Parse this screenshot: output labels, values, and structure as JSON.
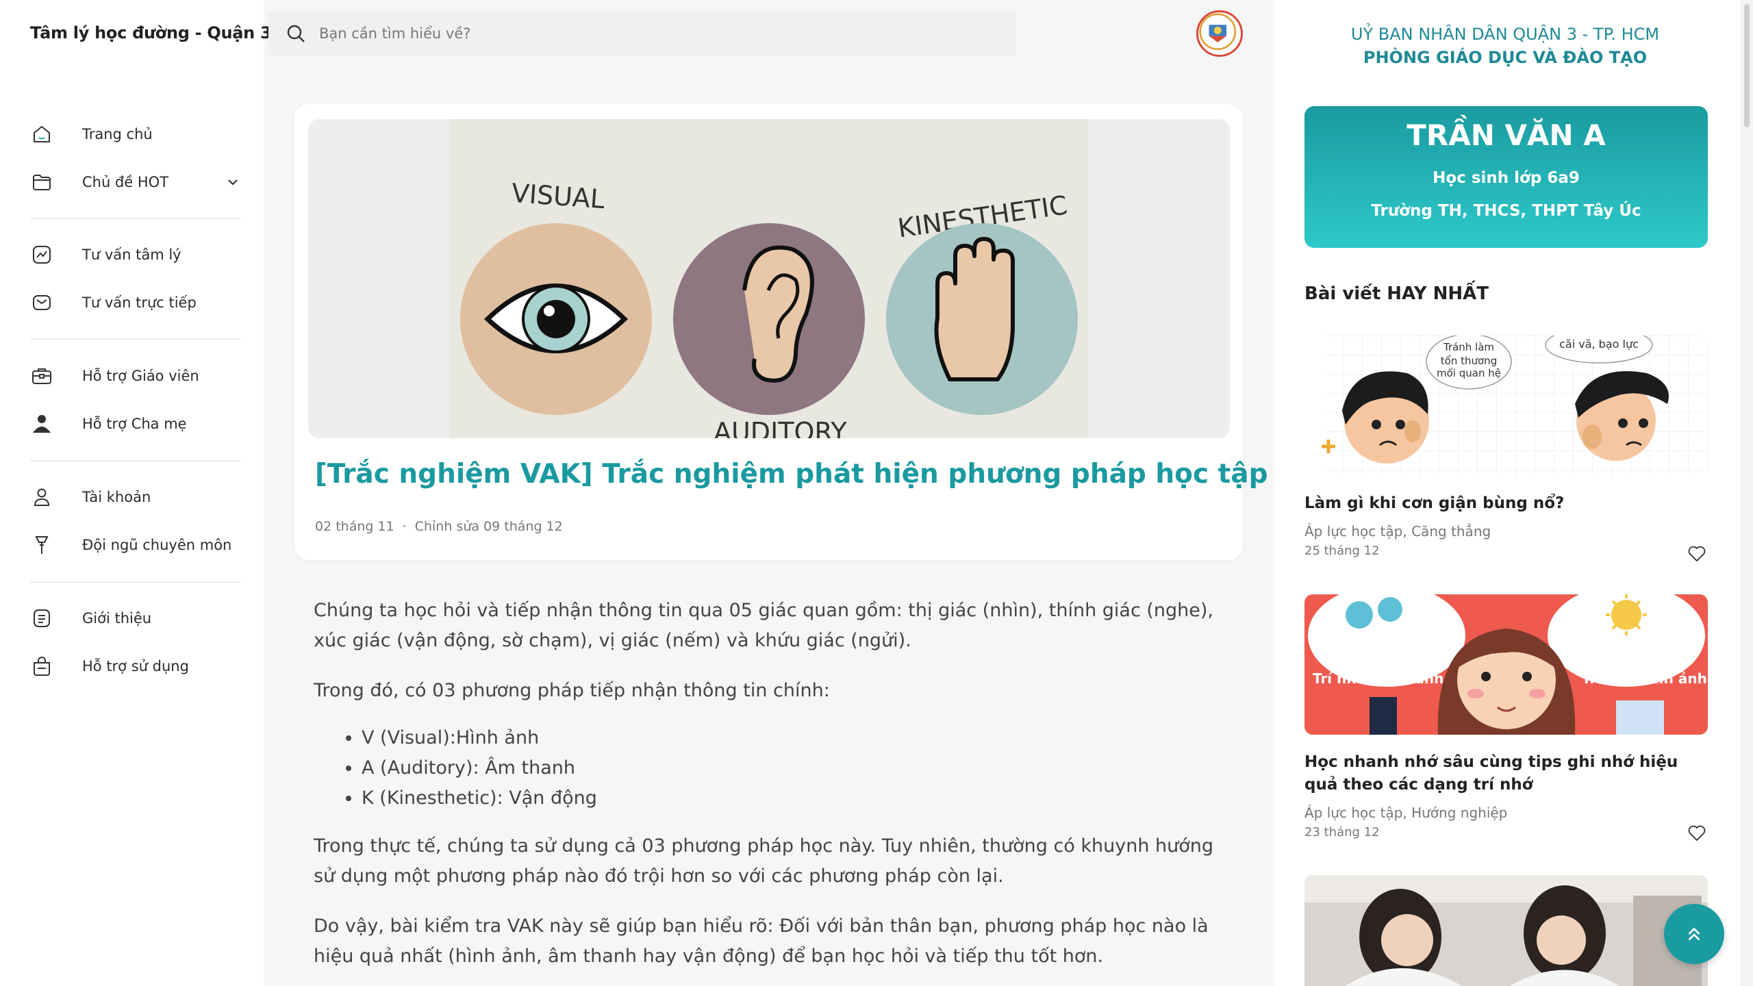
{
  "sidebar": {
    "brand": "Tâm lý học đường - Quận 3",
    "items": [
      {
        "label": "Trang chủ",
        "icon": "home-icon"
      },
      {
        "label": "Chủ đề HOT",
        "icon": "folder-icon"
      },
      {
        "label": "Tư vấn tâm lý",
        "icon": "chart-icon"
      },
      {
        "label": "Tư vấn trực tiếp",
        "icon": "mail-icon"
      },
      {
        "label": "Hỗ trợ Giáo viên",
        "icon": "briefcase-icon"
      },
      {
        "label": "Hỗ trợ Cha mẹ",
        "icon": "parent-icon"
      },
      {
        "label": "Tài khoản",
        "icon": "user-icon"
      },
      {
        "label": "Đội ngũ chuyên môn",
        "icon": "tool-icon"
      },
      {
        "label": "Giới thiệu",
        "icon": "document-icon"
      },
      {
        "label": "Hỗ trợ sử dụng",
        "icon": "bag-icon"
      }
    ]
  },
  "search": {
    "placeholder": "Bạn cần tìm hiểu về?"
  },
  "article": {
    "hero_labels": {
      "visual": "VISUAL",
      "kinesthetic": "KINESTHETIC",
      "auditory": "AUDITORY"
    },
    "title": "[Trắc nghiệm VAK] Trắc nghiệm phát hiện phương pháp học tập phù hợp",
    "date": "02 tháng 11",
    "edited": "Chỉnh sửa 09 tháng 12",
    "p1": " Chúng ta học hỏi và tiếp nhận thông tin qua 05 giác quan gồm: thị giác (nhìn), thính giác (nghe), xúc giác (vận động, sờ chạm), vị giác (nếm) và khứu giác (ngửi).",
    "p2": "Trong đó, có 03 phương pháp tiếp nhận thông tin chính:",
    "list": [
      "V (Visual):Hình ảnh",
      "A (Auditory): Âm thanh",
      "K (Kinesthetic): Vận động"
    ],
    "p3": "Trong thực tế, chúng ta sử dụng cả 03 phương pháp học này. Tuy nhiên, thường có khuynh hướng sử dụng một phương pháp nào đó trội hơn so với các phương pháp còn lại.",
    "p4": "Do vậy, bài kiểm tra VAK này sẽ giúp bạn hiểu rõ: Đối với bản thân bạn, phương pháp học nào là hiệu quả nhất (hình ảnh, âm thanh hay vận động) để bạn học hỏi và tiếp thu tốt hơn."
  },
  "right": {
    "org_line1": "UỶ BAN NHÂN DÂN QUẬN 3 - TP. HCM",
    "org_line2": "PHÒNG GIÁO DỤC VÀ ĐÀO TẠO",
    "profile": {
      "name": "TRẦN VĂN A",
      "class": "Học sinh lớp 6a9",
      "school": "Trường TH, THCS, THPT Tây Úc"
    },
    "best_title": "Bài viết HAY NHẤT",
    "posts": [
      {
        "title": "Làm gì khi cơn giận bùng nổ?",
        "tags": "Áp lực học tập, Căng thẳng",
        "date": "25 tháng 12",
        "thumb_text1": "Tránh làm tổn thương mối quan hệ",
        "thumb_text2": "cãi vã, bạo lực"
      },
      {
        "title": "Học nhanh nhớ sâu cùng tips ghi nhớ hiệu quả theo các dạng trí nhớ",
        "tags": "Áp lực học tập, Hướng nghiệp",
        "date": "23 tháng 12",
        "thumb_text1": "Trí nhớ âm thanh",
        "thumb_text2": "Trí nhớ hình ảnh"
      }
    ]
  },
  "colors": {
    "accent": "#1a9aa0",
    "brand_teal": "#2ec9c9"
  }
}
